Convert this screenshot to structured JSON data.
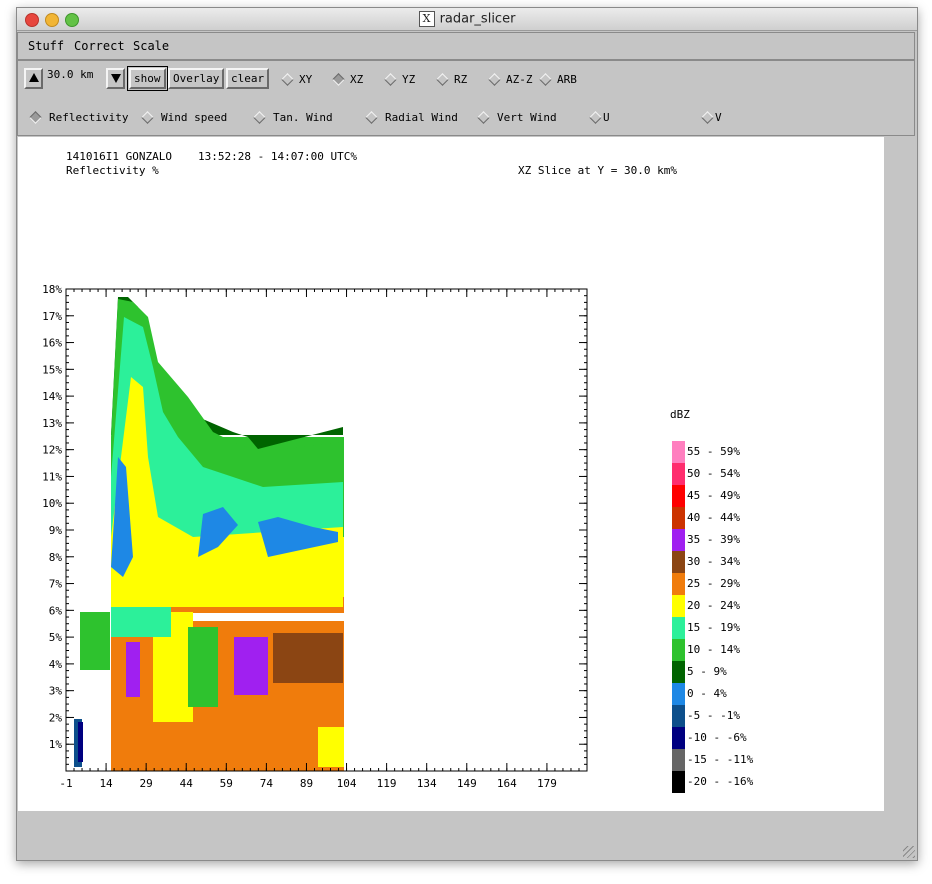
{
  "window": {
    "title": "radar_slicer"
  },
  "menu": {
    "stuff": "Stuff",
    "correct": "Correct",
    "scale": "Scale"
  },
  "toolbar": {
    "value": "30.0 km",
    "show": "show",
    "overlay": "Overlay",
    "clear": "clear",
    "slice_types": [
      "XY",
      "XZ",
      "YZ",
      "RZ",
      "AZ-Z",
      "ARB"
    ],
    "selected_slice": "XZ",
    "fields": [
      "Reflectivity",
      "Wind speed",
      "Tan. Wind",
      "Radial Wind",
      "Vert Wind",
      "U",
      "V"
    ],
    "selected_field": "Reflectivity"
  },
  "header": {
    "id": "141016I1 GONZALO",
    "time": "13:52:28 - 14:07:00 UTC%",
    "field": "Reflectivity %",
    "slice": "XZ Slice at Y = 30.0 km%"
  },
  "legend": {
    "title": "dBZ",
    "entries": [
      {
        "label": "55 - 59%",
        "color": "#ff7fbf"
      },
      {
        "label": "50 - 54%",
        "color": "#ff2d6e"
      },
      {
        "label": "45 - 49%",
        "color": "#ff0000"
      },
      {
        "label": "40 - 44%",
        "color": "#cc3300"
      },
      {
        "label": "35 - 39%",
        "color": "#a020f0"
      },
      {
        "label": "30 - 34%",
        "color": "#8b4513"
      },
      {
        "label": "25 - 29%",
        "color": "#f07c0c"
      },
      {
        "label": "20 - 24%",
        "color": "#ffff00"
      },
      {
        "label": "15 - 19%",
        "color": "#2cf09a"
      },
      {
        "label": "10 - 14%",
        "color": "#2ec22e"
      },
      {
        "label": "5 - 9%",
        "color": "#006400"
      },
      {
        "label": "0 - 4%",
        "color": "#1e88e5"
      },
      {
        "label": "-5 - -1%",
        "color": "#0d4f8b"
      },
      {
        "label": "-10 - -6%",
        "color": "#000080"
      },
      {
        "label": "-15 - -11%",
        "color": "#666666"
      },
      {
        "label": "-20 - -16%",
        "color": "#000000"
      }
    ]
  },
  "chart_data": {
    "type": "heatmap",
    "xlabel": "",
    "ylabel": "",
    "x_ticks": [
      "-1",
      "14",
      "29",
      "44",
      "59",
      "74",
      "89",
      "104",
      "119",
      "134",
      "149",
      "164",
      "179"
    ],
    "x_tick_values": [
      -1,
      14,
      29,
      44,
      59,
      74,
      89,
      104,
      119,
      134,
      149,
      164,
      179
    ],
    "y_ticks": [
      "1%",
      "2%",
      "3%",
      "4%",
      "5%",
      "6%",
      "7%",
      "8%",
      "9%",
      "10%",
      "11%",
      "12%",
      "13%",
      "14%",
      "15%",
      "16%",
      "17%",
      "18%"
    ],
    "y_tick_values": [
      1,
      2,
      3,
      4,
      5,
      6,
      7,
      8,
      9,
      10,
      11,
      12,
      13,
      14,
      15,
      16,
      17,
      18
    ],
    "xlim": [
      -1,
      194
    ],
    "ylim": [
      0,
      18
    ],
    "colorbar_label": "dBZ"
  }
}
